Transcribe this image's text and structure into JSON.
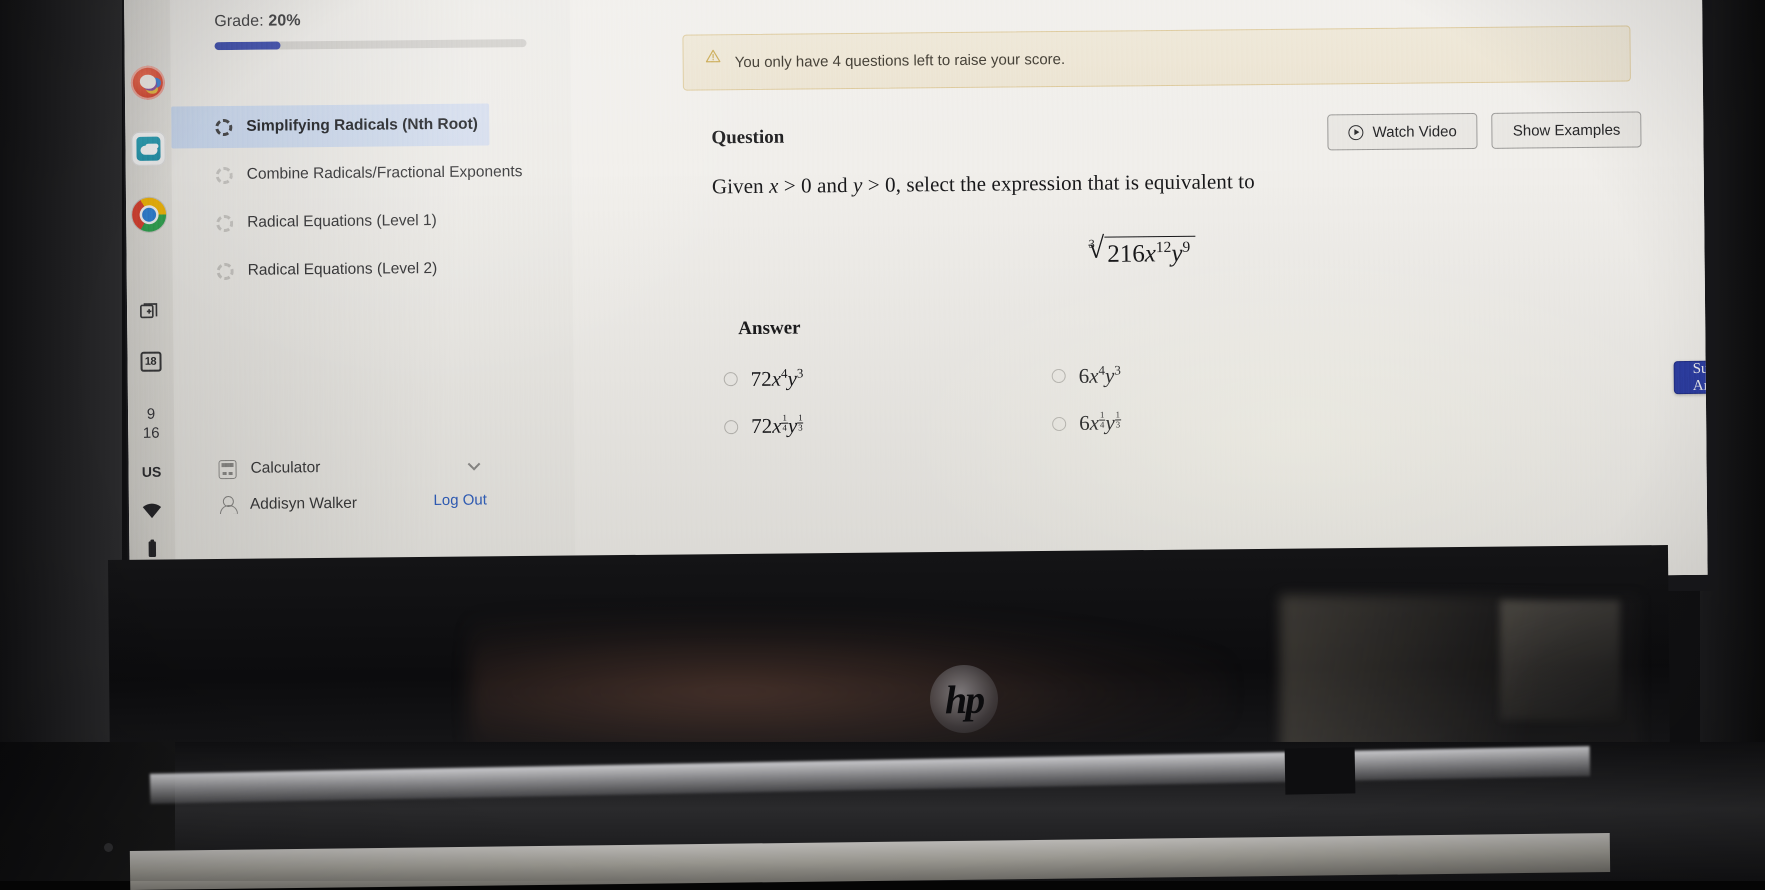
{
  "taskbar": {
    "apps": [
      {
        "name": "paint-3d-icon",
        "label": "Paint 3D"
      },
      {
        "name": "onedrive-icon",
        "label": "OneDrive"
      },
      {
        "name": "chrome-icon",
        "label": "Google Chrome"
      }
    ],
    "task_view_label": "Task View",
    "calendar_day": "18",
    "clock_hour": "9",
    "clock_minute": "16",
    "locale": "US",
    "wifi_label": "Wi-Fi",
    "battery_label": "Battery"
  },
  "sidebar": {
    "grade_prefix": "Grade:",
    "grade_value": "20%",
    "grade_percent": 21,
    "items": [
      {
        "label": "Simplifying Radicals (Nth Root)",
        "active": true
      },
      {
        "label": "Combine Radicals/Fractional Exponents",
        "active": false
      },
      {
        "label": "Radical Equations (Level 1)",
        "active": false
      },
      {
        "label": "Radical Equations (Level 2)",
        "active": false
      }
    ],
    "calculator_label": "Calculator",
    "user_name": "Addisyn Walker",
    "logout_label": "Log Out"
  },
  "progress": {
    "segments": [
      100,
      100,
      100,
      100
    ]
  },
  "alert": {
    "icon": "warning-triangle-icon",
    "message": "You only have 4 questions left to raise your score."
  },
  "question": {
    "heading": "Question",
    "watch_video_label": "Watch Video",
    "show_examples_label": "Show Examples",
    "prompt_part1": "Given ",
    "prompt_x": "x",
    "prompt_gt1": " > 0",
    "prompt_and": " and ",
    "prompt_y": "y",
    "prompt_gt2": " > 0",
    "prompt_part2": ", select the expression that is equivalent to",
    "expression": {
      "index": "3",
      "radicand_coeff": "216",
      "radicand_x": "x",
      "radicand_x_exp": "12",
      "radicand_y": "y",
      "radicand_y_exp": "9",
      "plain": "cube root of 216x^12 y^9"
    }
  },
  "answer": {
    "label": "Answer",
    "choices": [
      {
        "coeff": "72",
        "x_num": "4",
        "x_den": "",
        "y_num": "3",
        "y_den": "",
        "plain": "72x^4 y^3",
        "selected": false
      },
      {
        "coeff": "6",
        "x_num": "4",
        "x_den": "",
        "y_num": "3",
        "y_den": "",
        "plain": "6x^4 y^3",
        "selected": false
      },
      {
        "coeff": "72",
        "x_num": "1",
        "x_den": "4",
        "y_num": "1",
        "y_den": "3",
        "plain": "72x^(1/4) y^(1/3)",
        "selected": false
      },
      {
        "coeff": "6",
        "x_num": "1",
        "x_den": "4",
        "y_num": "1",
        "y_den": "3",
        "plain": "6x^(1/4) y^(1/3)",
        "selected": false
      }
    ],
    "submit_label": "Submit Answer"
  },
  "hardware": {
    "brand_logo": "hp"
  },
  "colors": {
    "accent_blue": "#2c3da4",
    "link_blue": "#2f5fbf",
    "alert_border": "#ddc99a",
    "alert_bg": "#ece4d2",
    "active_nav_bg": "#c7d7ef",
    "screen_bg": "#edebe7"
  }
}
